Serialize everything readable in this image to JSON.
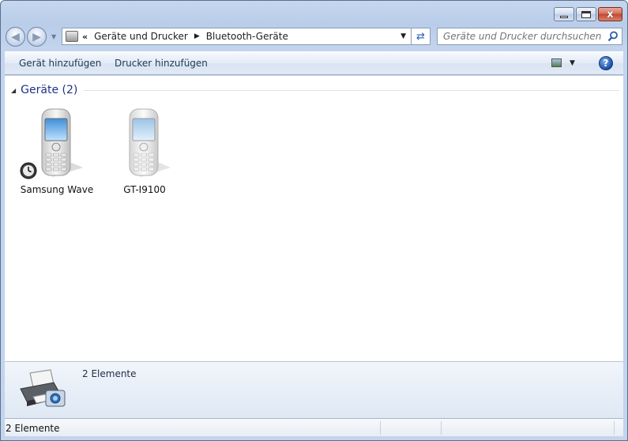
{
  "window": {
    "minimize_label": "",
    "maximize_label": "",
    "close_label": "x"
  },
  "navigation": {
    "breadcrumb": [
      "«",
      "Geräte und Drucker",
      "Bluetooth-Geräte"
    ],
    "search_placeholder": "Geräte und Drucker durchsuchen"
  },
  "toolbar": {
    "add_device": "Gerät hinzufügen",
    "add_printer": "Drucker hinzufügen",
    "help_label": "?"
  },
  "group": {
    "title": "Geräte (2)"
  },
  "devices": [
    {
      "name": "Samsung Wave",
      "badge": "clock-icon"
    },
    {
      "name": "GT-I9100"
    }
  ],
  "details": {
    "count": "2 Elemente"
  },
  "status": {
    "text": "2 Elemente"
  },
  "colors": {
    "group_title": "#1e3287",
    "close_button": "#c2462e",
    "chrome": "#b9cde9"
  }
}
